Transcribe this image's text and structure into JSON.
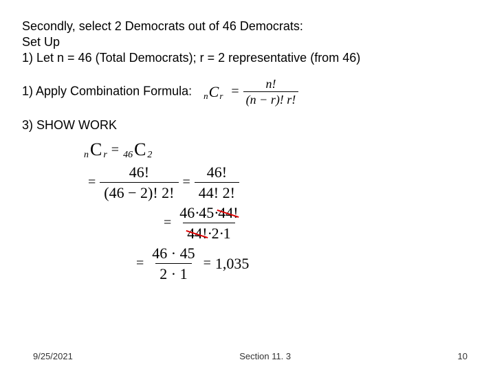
{
  "heading": "Secondly, select 2 Democrats out of 46 Democrats:",
  "setup_label": "Set Up",
  "step1": "1)   Let n = 46 (Total Democrats); r = 2 representative (from 46)",
  "step2_label": "1)   Apply Combination Formula:",
  "step3_label": "3)   SHOW WORK",
  "formula": {
    "left_presub": "n",
    "C": "C",
    "left_postsub": "r",
    "eq": "=",
    "num": "n!",
    "den": "(n − r)! r!"
  },
  "work": {
    "line1": {
      "lhs_pre": "n",
      "lhs_C": "C",
      "lhs_post": "r",
      "eq": "=",
      "rhs_pre": "46",
      "rhs_C": "C",
      "rhs_post": "2"
    },
    "line2": {
      "eq": "=",
      "num1": "46!",
      "den1": "(46 − 2)! 2!",
      "eq2": "=",
      "num2": "46!",
      "den2": "44! 2!"
    },
    "line3": {
      "eq": "=",
      "num_a": "46",
      "dot1": "·",
      "num_b": "45",
      "dot2": "·",
      "num_cancel": "44!",
      "den_cancel": "44!",
      "dot3": "·",
      "den_a": "2",
      "dot4": "·",
      "den_b": "1"
    },
    "line4": {
      "eq": "=",
      "num": "46 · 45",
      "den": "2 · 1",
      "eq2": "=",
      "result": "1,035"
    }
  },
  "chart_data": {
    "type": "table",
    "title": "Combination computation nCr with n=46, r=2",
    "formula": "nCr = n! / ((n-r)! r!)",
    "n": 46,
    "r": 2,
    "steps": [
      "46C2 = 46! / ((46-2)! 2!)",
      "= 46! / (44! 2!)",
      "= (46 · 45 · 44!) / (44! · 2 · 1)",
      "= (46 · 45) / (2 · 1)",
      "= 1035"
    ],
    "result": 1035
  },
  "footer": {
    "date": "9/25/2021",
    "section": "Section 11. 3",
    "page": "10"
  }
}
